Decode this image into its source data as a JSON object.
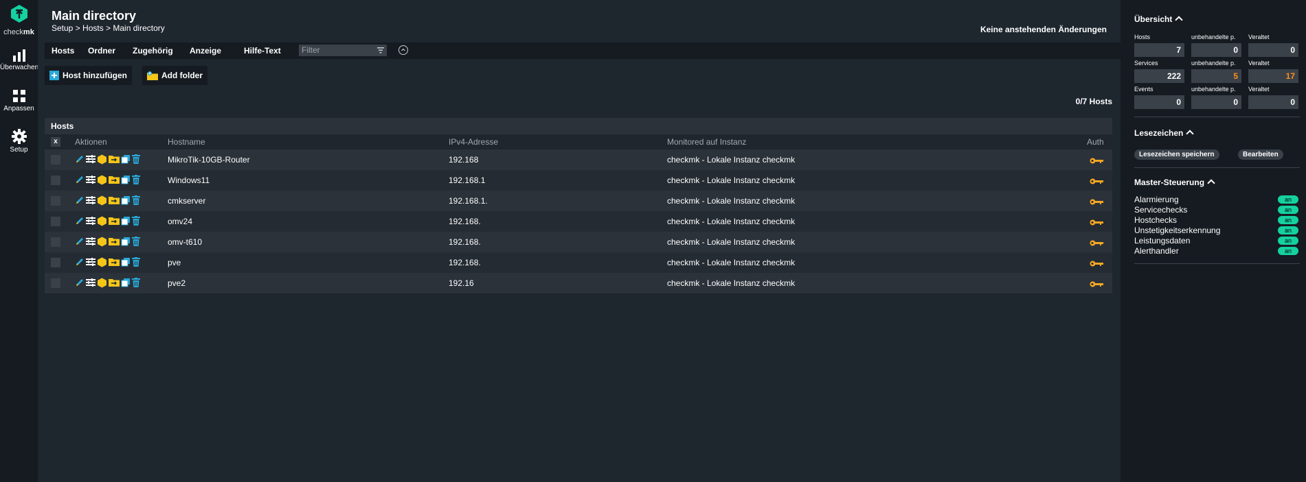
{
  "nav": {
    "logo_text_a": "check",
    "logo_text_b": "mk",
    "items": [
      {
        "label": "Überwachen",
        "icon": "monitor-bars-icon"
      },
      {
        "label": "Anpassen",
        "icon": "customize-grid-icon"
      },
      {
        "label": "Setup",
        "icon": "setup-gear-icon"
      }
    ]
  },
  "header": {
    "title": "Main directory",
    "breadcrumb": "Setup > Hosts > Main directory",
    "pending": "Keine anstehenden Änderungen"
  },
  "menubar": {
    "items": [
      "Hosts",
      "Ordner",
      "Zugehörig",
      "Anzeige",
      "Hilfe-Text"
    ],
    "filter_placeholder": "Filter"
  },
  "buttons": {
    "add_host": "Host hinzufügen",
    "add_folder": "Add folder"
  },
  "host_count": "0/7 Hosts",
  "table": {
    "title": "Hosts",
    "clear_label": "x",
    "columns": {
      "actions": "Aktionen",
      "hostname": "Hostname",
      "ipv4": "IPv4-Adresse",
      "site": "Monitored auf Instanz",
      "auth": "Auth"
    },
    "rows": [
      {
        "hostname": "MikroTik-10GB-Router",
        "ipv4": "192.168",
        "site": "checkmk - Lokale Instanz checkmk"
      },
      {
        "hostname": "Windows11",
        "ipv4": "192.168.1",
        "site": "checkmk - Lokale Instanz checkmk"
      },
      {
        "hostname": "cmkserver",
        "ipv4": "192.168.1.",
        "site": "checkmk - Lokale Instanz checkmk"
      },
      {
        "hostname": "omv24",
        "ipv4": "192.168.",
        "site": "checkmk - Lokale Instanz checkmk"
      },
      {
        "hostname": "omv-t610",
        "ipv4": "192.168.",
        "site": "checkmk - Lokale Instanz checkmk"
      },
      {
        "hostname": "pve",
        "ipv4": "192.168.",
        "site": "checkmk - Lokale Instanz checkmk"
      },
      {
        "hostname": "pve2",
        "ipv4": "192.16",
        "site": "checkmk - Lokale Instanz checkmk"
      }
    ]
  },
  "sidebar": {
    "overview": {
      "title": "Übersicht",
      "labels": {
        "hosts": "Hosts",
        "services": "Services",
        "events": "Events",
        "unhandled": "unbehandelte p.",
        "stale": "Veraltet"
      },
      "hosts": {
        "total": "7",
        "unhandled": "0",
        "stale": "0"
      },
      "services": {
        "total": "222",
        "unhandled": "5",
        "stale": "17"
      },
      "events": {
        "total": "0",
        "unhandled": "0",
        "stale": "0"
      }
    },
    "bookmarks": {
      "title": "Lesezeichen",
      "save": "Lesezeichen speichern",
      "edit": "Bearbeiten"
    },
    "master": {
      "title": "Master-Steuerung",
      "items": [
        {
          "label": "Alarmierung",
          "state": "an"
        },
        {
          "label": "Servicechecks",
          "state": "an"
        },
        {
          "label": "Hostchecks",
          "state": "an"
        },
        {
          "label": "Unstetigkeitserkennung",
          "state": "an"
        },
        {
          "label": "Leistungsdaten",
          "state": "an"
        },
        {
          "label": "Alerthandler",
          "state": "an"
        }
      ]
    }
  },
  "colors": {
    "accent": "#15d1a0",
    "warn": "#ff8f1f",
    "auth_key": "#f5a623"
  }
}
